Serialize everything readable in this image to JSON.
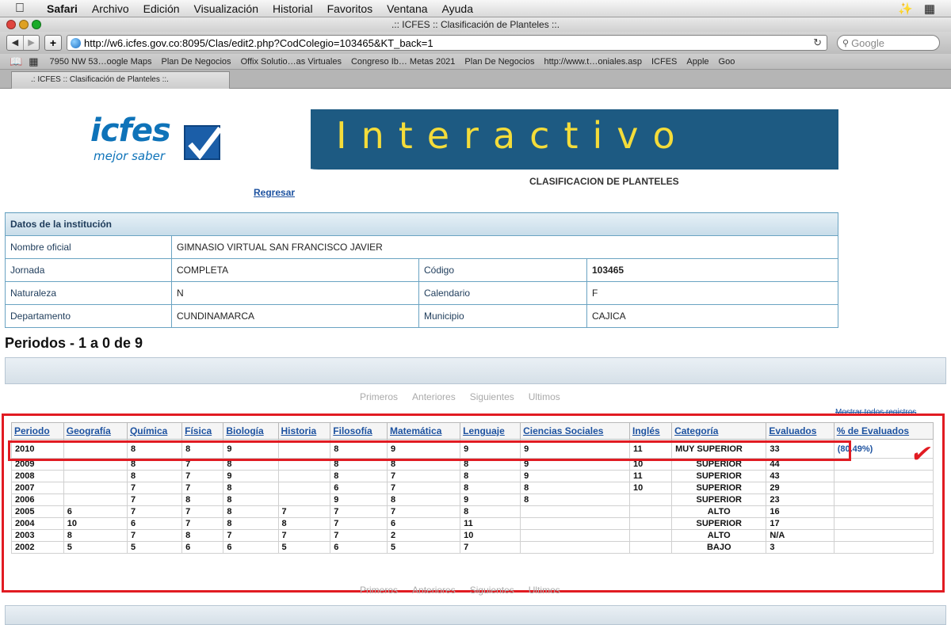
{
  "menubar": {
    "app": "Safari",
    "items": [
      "Archivo",
      "Edición",
      "Visualización",
      "Historial",
      "Favoritos",
      "Ventana",
      "Ayuda"
    ]
  },
  "window": {
    "title": ".:: ICFES :: Clasificación de Planteles ::."
  },
  "toolbar": {
    "url": "http://w6.icfes.gov.co:8095/Clas/edit2.php?CodColegio=103465&KT_back=1",
    "search_placeholder": "Google"
  },
  "bookmarks": [
    "7950 NW 53…oogle Maps",
    "Plan De Negocios",
    "Offix Solutio…as Virtuales",
    "Congreso Ib… Metas 2021",
    "Plan De Negocios",
    "http://www.t…oniales.asp",
    "ICFES",
    "Apple",
    "Goo"
  ],
  "tab": {
    "label": ".: ICFES :: Clasificación de Planteles ::."
  },
  "banner": {
    "logo_text": "icfes",
    "logo_sub": "mejor saber",
    "title": "Interactivo",
    "subhead": "CLASIFICACION DE PLANTELES",
    "back_link": "Regresar"
  },
  "institution": {
    "header": "Datos de la institución",
    "nombre_label": "Nombre oficial",
    "nombre_value": "GIMNASIO VIRTUAL SAN FRANCISCO JAVIER",
    "jornada_label": "Jornada",
    "jornada_value": "COMPLETA",
    "codigo_label": "Código",
    "codigo_value": "103465",
    "naturaleza_label": "Naturaleza",
    "naturaleza_value": "N",
    "calendario_label": "Calendario",
    "calendario_value": "F",
    "departamento_label": "Departamento",
    "departamento_value": "CUNDINAMARCA",
    "municipio_label": "Municipio",
    "municipio_value": "CAJICA"
  },
  "periodos_title": "Periodos - 1 a 0 de 9",
  "pager": [
    "Primeros",
    "Anteriores",
    "Siguientes",
    "Ultimos"
  ],
  "mostrar_link": "Mostrar todos registros",
  "grid": {
    "headers": [
      "Periodo",
      "Geografía",
      "Química",
      "Física",
      "Biología",
      "Historia",
      "Filosofía",
      "Matemática",
      "Lenguaje",
      "Ciencias Sociales",
      "Inglés",
      "Categoría",
      "Evaluados",
      "% de Evaluados"
    ],
    "rows": [
      [
        "2010",
        "",
        "8",
        "8",
        "9",
        "",
        "8",
        "9",
        "9",
        "9",
        "11",
        "MUY SUPERIOR",
        "33",
        "(80.49%)"
      ],
      [
        "2009",
        "",
        "8",
        "7",
        "8",
        "",
        "8",
        "8",
        "8",
        "9",
        "10",
        "SUPERIOR",
        "44",
        ""
      ],
      [
        "2008",
        "",
        "8",
        "7",
        "9",
        "",
        "8",
        "7",
        "8",
        "9",
        "11",
        "SUPERIOR",
        "43",
        ""
      ],
      [
        "2007",
        "",
        "7",
        "7",
        "8",
        "",
        "6",
        "7",
        "8",
        "8",
        "10",
        "SUPERIOR",
        "29",
        ""
      ],
      [
        "2006",
        "",
        "7",
        "8",
        "8",
        "",
        "9",
        "8",
        "9",
        "8",
        "",
        "SUPERIOR",
        "23",
        ""
      ],
      [
        "2005",
        "6",
        "7",
        "7",
        "8",
        "7",
        "7",
        "7",
        "8",
        "",
        "",
        "ALTO",
        "16",
        ""
      ],
      [
        "2004",
        "10",
        "6",
        "7",
        "8",
        "8",
        "7",
        "6",
        "11",
        "",
        "",
        "SUPERIOR",
        "17",
        ""
      ],
      [
        "2003",
        "8",
        "7",
        "8",
        "7",
        "7",
        "7",
        "2",
        "10",
        "",
        "",
        "ALTO",
        "N/A",
        ""
      ],
      [
        "2002",
        "5",
        "5",
        "6",
        "6",
        "5",
        "6",
        "5",
        "7",
        "",
        "",
        "BAJO",
        "3",
        ""
      ]
    ]
  },
  "colors": {
    "annotation_red": "#e11b22",
    "link_blue": "#1d52a0",
    "banner_yellow": "#f4dc3a",
    "banner_blue": "#1d5a82"
  }
}
